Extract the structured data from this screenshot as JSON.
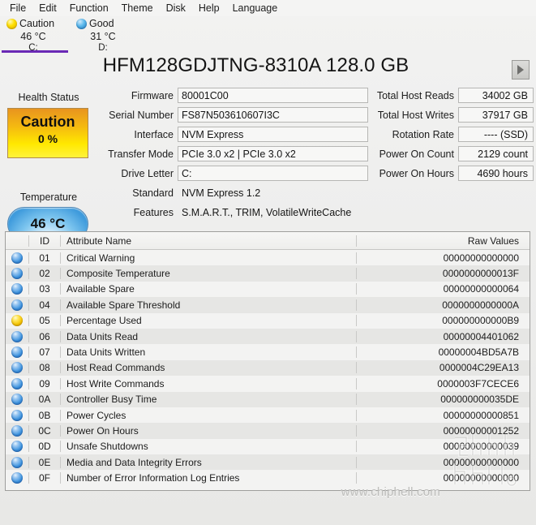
{
  "menu": {
    "items": [
      "File",
      "Edit",
      "Function",
      "Theme",
      "Disk",
      "Help",
      "Language"
    ]
  },
  "disk_tabs": [
    {
      "state": "Caution",
      "temperature": "46 °C",
      "letter": "C:",
      "dot": "caution-dot",
      "active": true
    },
    {
      "state": "Good",
      "temperature": "31 °C",
      "letter": "D:",
      "dot": "good-dot",
      "active": false
    }
  ],
  "header": {
    "model_title": "HFM128GDJTNG-8310A 128.0 GB",
    "next_button_icon": "play-triangle-icon"
  },
  "health": {
    "label": "Health Status",
    "state": "Caution",
    "percent": "0 %",
    "accent_color": "#ffe800"
  },
  "temperature": {
    "label": "Temperature",
    "value": "46 °C",
    "accent_color": "#3f9bdc"
  },
  "fields_left": [
    {
      "label": "Firmware",
      "value": "80001C00",
      "boxed": true
    },
    {
      "label": "Serial Number",
      "value": "FS87N503610607I3C",
      "boxed": true
    },
    {
      "label": "Interface",
      "value": "NVM Express",
      "boxed": true
    },
    {
      "label": "Transfer Mode",
      "value": "PCIe 3.0 x2 | PCIe 3.0 x2",
      "boxed": true
    },
    {
      "label": "Drive Letter",
      "value": "C:",
      "boxed": true
    },
    {
      "label": "Standard",
      "value": "NVM Express 1.2",
      "boxed": false
    },
    {
      "label": "Features",
      "value": "S.M.A.R.T., TRIM, VolatileWriteCache",
      "boxed": false
    }
  ],
  "fields_right": [
    {
      "label": "Total Host Reads",
      "value": "34002 GB"
    },
    {
      "label": "Total Host Writes",
      "value": "37917 GB"
    },
    {
      "label": "Rotation Rate",
      "value": "---- (SSD)"
    },
    {
      "label": "Power On Count",
      "value": "2129 count"
    },
    {
      "label": "Power On Hours",
      "value": "4690 hours"
    }
  ],
  "smart_table": {
    "columns": {
      "id": "ID",
      "name": "Attribute Name",
      "raw": "Raw Values"
    },
    "rows": [
      {
        "status": "blue",
        "id": "01",
        "name": "Critical Warning",
        "raw": "00000000000000"
      },
      {
        "status": "blue",
        "id": "02",
        "name": "Composite Temperature",
        "raw": "0000000000013F"
      },
      {
        "status": "blue",
        "id": "03",
        "name": "Available Spare",
        "raw": "00000000000064"
      },
      {
        "status": "blue",
        "id": "04",
        "name": "Available Spare Threshold",
        "raw": "0000000000000A"
      },
      {
        "status": "yellow",
        "id": "05",
        "name": "Percentage Used",
        "raw": "000000000000B9"
      },
      {
        "status": "blue",
        "id": "06",
        "name": "Data Units Read",
        "raw": "00000004401062"
      },
      {
        "status": "blue",
        "id": "07",
        "name": "Data Units Written",
        "raw": "00000004BD5A7B"
      },
      {
        "status": "blue",
        "id": "08",
        "name": "Host Read Commands",
        "raw": "0000004C29EA13"
      },
      {
        "status": "blue",
        "id": "09",
        "name": "Host Write Commands",
        "raw": "0000003F7CECE6"
      },
      {
        "status": "blue",
        "id": "0A",
        "name": "Controller Busy Time",
        "raw": "000000000035DE"
      },
      {
        "status": "blue",
        "id": "0B",
        "name": "Power Cycles",
        "raw": "00000000000851"
      },
      {
        "status": "blue",
        "id": "0C",
        "name": "Power On Hours",
        "raw": "00000000001252"
      },
      {
        "status": "blue",
        "id": "0D",
        "name": "Unsafe Shutdowns",
        "raw": "00000000000039"
      },
      {
        "status": "blue",
        "id": "0E",
        "name": "Media and Data Integrity Errors",
        "raw": "00000000000000"
      },
      {
        "status": "blue",
        "id": "0F",
        "name": "Number of Error Information Log Entries",
        "raw": "00000000000000"
      }
    ]
  },
  "watermark": {
    "text": "www.chiphell.com",
    "logo": "chiphell-logo"
  }
}
